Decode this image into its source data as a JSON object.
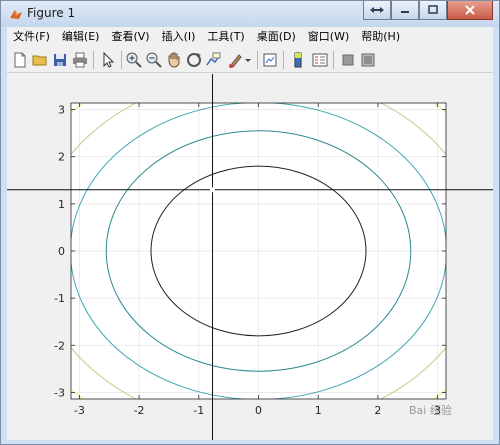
{
  "window": {
    "title": "Figure 1"
  },
  "menu": [
    "文件(F)",
    "编辑(E)",
    "查看(V)",
    "插入(I)",
    "工具(T)",
    "桌面(D)",
    "窗口(W)",
    "帮助(H)"
  ],
  "toolbar": {
    "buttons": [
      "new-figure",
      "open-file",
      "save",
      "print",
      "select-pointer",
      "zoom-in",
      "zoom-out",
      "pan",
      "rotate-3d",
      "data-cursor",
      "brush",
      "link-plot",
      "dock-figure",
      "insert-colorbar",
      "insert-legend",
      "hide-plot-tools",
      "show-plot-tools"
    ]
  },
  "watermark": "Bai 经验",
  "chart_data": {
    "type": "contour",
    "xlim": [
      -3.14,
      3.14
    ],
    "ylim": [
      -3.14,
      3.14
    ],
    "x_ticks": [
      -3,
      -2,
      -1,
      0,
      1,
      2,
      3
    ],
    "y_ticks": [
      -3,
      -2,
      -1,
      0,
      1,
      2,
      3
    ],
    "grid": true,
    "contours": [
      {
        "rx": 1.8,
        "ry": 1.8,
        "color": "#222222"
      },
      {
        "rx": 2.55,
        "ry": 2.55,
        "color": "#2a8a8f"
      },
      {
        "rx": 3.15,
        "ry": 3.15,
        "color": "#3ca7b0"
      },
      {
        "rx": 3.75,
        "ry": 3.75,
        "color": "#c8c98a"
      },
      {
        "rx": 4.3,
        "ry": 4.3,
        "color": "#f0e87a"
      }
    ],
    "crosshair": {
      "x": -0.77,
      "y": 1.3
    }
  }
}
